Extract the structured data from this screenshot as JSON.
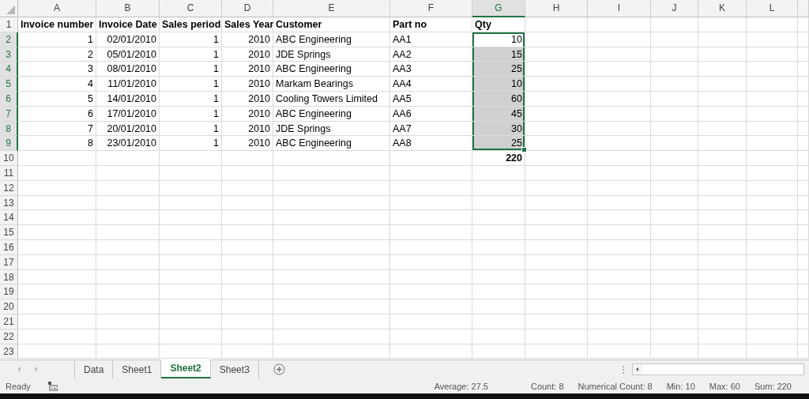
{
  "columns": [
    {
      "letter": "A",
      "selected": false
    },
    {
      "letter": "B",
      "selected": false
    },
    {
      "letter": "C",
      "selected": false
    },
    {
      "letter": "D",
      "selected": false
    },
    {
      "letter": "E",
      "selected": false
    },
    {
      "letter": "F",
      "selected": false
    },
    {
      "letter": "G",
      "selected": true
    },
    {
      "letter": "H",
      "selected": false
    },
    {
      "letter": "I",
      "selected": false
    },
    {
      "letter": "J",
      "selected": false
    },
    {
      "letter": "K",
      "selected": false
    },
    {
      "letter": "L",
      "selected": false
    }
  ],
  "header_row": {
    "number": "1",
    "selected": false,
    "cells": [
      "Invoice number",
      "Invoice Date",
      "Sales period",
      "Sales Year",
      "Customer",
      "Part no",
      "Qty"
    ]
  },
  "data_rows": [
    {
      "number": "2",
      "selected": true,
      "cells": [
        "1",
        "02/01/2010",
        "1",
        "2010",
        "ABC Engineering",
        "AA1"
      ],
      "qty_cell": {
        "value": "10",
        "selected": true,
        "active": true
      }
    },
    {
      "number": "3",
      "selected": true,
      "cells": [
        "2",
        "05/01/2010",
        "1",
        "2010",
        "JDE Springs",
        "AA2"
      ],
      "qty_cell": {
        "value": "15",
        "selected": true,
        "active": false
      }
    },
    {
      "number": "4",
      "selected": true,
      "cells": [
        "3",
        "08/01/2010",
        "1",
        "2010",
        "ABC Engineering",
        "AA3"
      ],
      "qty_cell": {
        "value": "25",
        "selected": true,
        "active": false
      }
    },
    {
      "number": "5",
      "selected": true,
      "cells": [
        "4",
        "11/01/2010",
        "1",
        "2010",
        "Markam Bearings",
        "AA4"
      ],
      "qty_cell": {
        "value": "10",
        "selected": true,
        "active": false
      }
    },
    {
      "number": "6",
      "selected": true,
      "cells": [
        "5",
        "14/01/2010",
        "1",
        "2010",
        "Cooling Towers Limited",
        "AA5"
      ],
      "qty_cell": {
        "value": "60",
        "selected": true,
        "active": false
      }
    },
    {
      "number": "7",
      "selected": true,
      "cells": [
        "6",
        "17/01/2010",
        "1",
        "2010",
        "ABC Engineering",
        "AA6"
      ],
      "qty_cell": {
        "value": "45",
        "selected": true,
        "active": false
      }
    },
    {
      "number": "8",
      "selected": true,
      "cells": [
        "7",
        "20/01/2010",
        "1",
        "2010",
        "JDE Springs",
        "AA7"
      ],
      "qty_cell": {
        "value": "30",
        "selected": true,
        "active": false
      }
    },
    {
      "number": "9",
      "selected": true,
      "cells": [
        "8",
        "23/01/2010",
        "1",
        "2010",
        "ABC Engineering",
        "AA8"
      ],
      "qty_cell": {
        "value": "25",
        "selected": true,
        "active": false
      }
    }
  ],
  "total_row": {
    "number": "10",
    "selected": false,
    "total": "220"
  },
  "empty_rows": [
    "11",
    "12",
    "13",
    "14",
    "15",
    "16",
    "17",
    "18",
    "19",
    "20",
    "21",
    "22",
    "23"
  ],
  "sheet_tabs": [
    {
      "label": "Data",
      "selected": false
    },
    {
      "label": "Sheet1",
      "selected": false
    },
    {
      "label": "Sheet2",
      "selected": true
    },
    {
      "label": "Sheet3",
      "selected": false
    }
  ],
  "status_bar": {
    "mode": "Ready",
    "stats": [
      "Average: 27.5",
      "Count: 8",
      "Numerical Count: 8",
      "Min: 10",
      "Max: 60",
      "Sum: 220"
    ]
  }
}
